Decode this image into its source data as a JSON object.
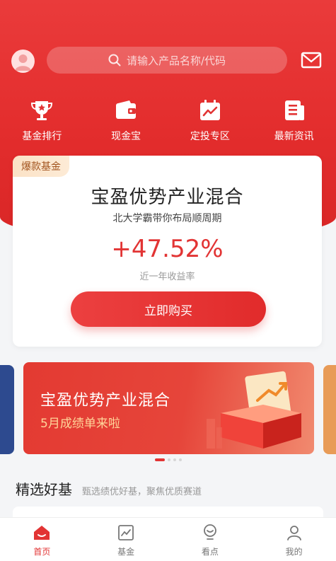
{
  "search": {
    "placeholder": "请输入产品名称/代码"
  },
  "quick_links": [
    {
      "label": "基金排行",
      "icon": "trophy-icon"
    },
    {
      "label": "现金宝",
      "icon": "wallet-icon"
    },
    {
      "label": "定投专区",
      "icon": "calendar-chart-icon"
    },
    {
      "label": "最新资讯",
      "icon": "news-icon"
    }
  ],
  "featured": {
    "tag": "爆款基金",
    "title": "宝盈优势产业混合",
    "subtitle": "北大学霸带你布局顺周期",
    "rate": "+47.52%",
    "rate_label": "近一年收益率",
    "button": "立即购买"
  },
  "banner": {
    "title": "宝盈优势产业混合",
    "subtitle": "5月成绩单来啦",
    "active_index": 0,
    "count": 4
  },
  "section": {
    "title": "精选好基",
    "subtitle": "甄选绩优好基，聚焦优质赛道"
  },
  "tabs": [
    {
      "label": "首页",
      "icon": "home-icon",
      "active": true
    },
    {
      "label": "基金",
      "icon": "fund-chart-icon",
      "active": false
    },
    {
      "label": "看点",
      "icon": "bulb-icon",
      "active": false
    },
    {
      "label": "我的",
      "icon": "user-icon",
      "active": false
    }
  ],
  "colors": {
    "brand": "#e23434",
    "tag_bg": "#fbe2c6",
    "tag_text": "#a2541f"
  }
}
